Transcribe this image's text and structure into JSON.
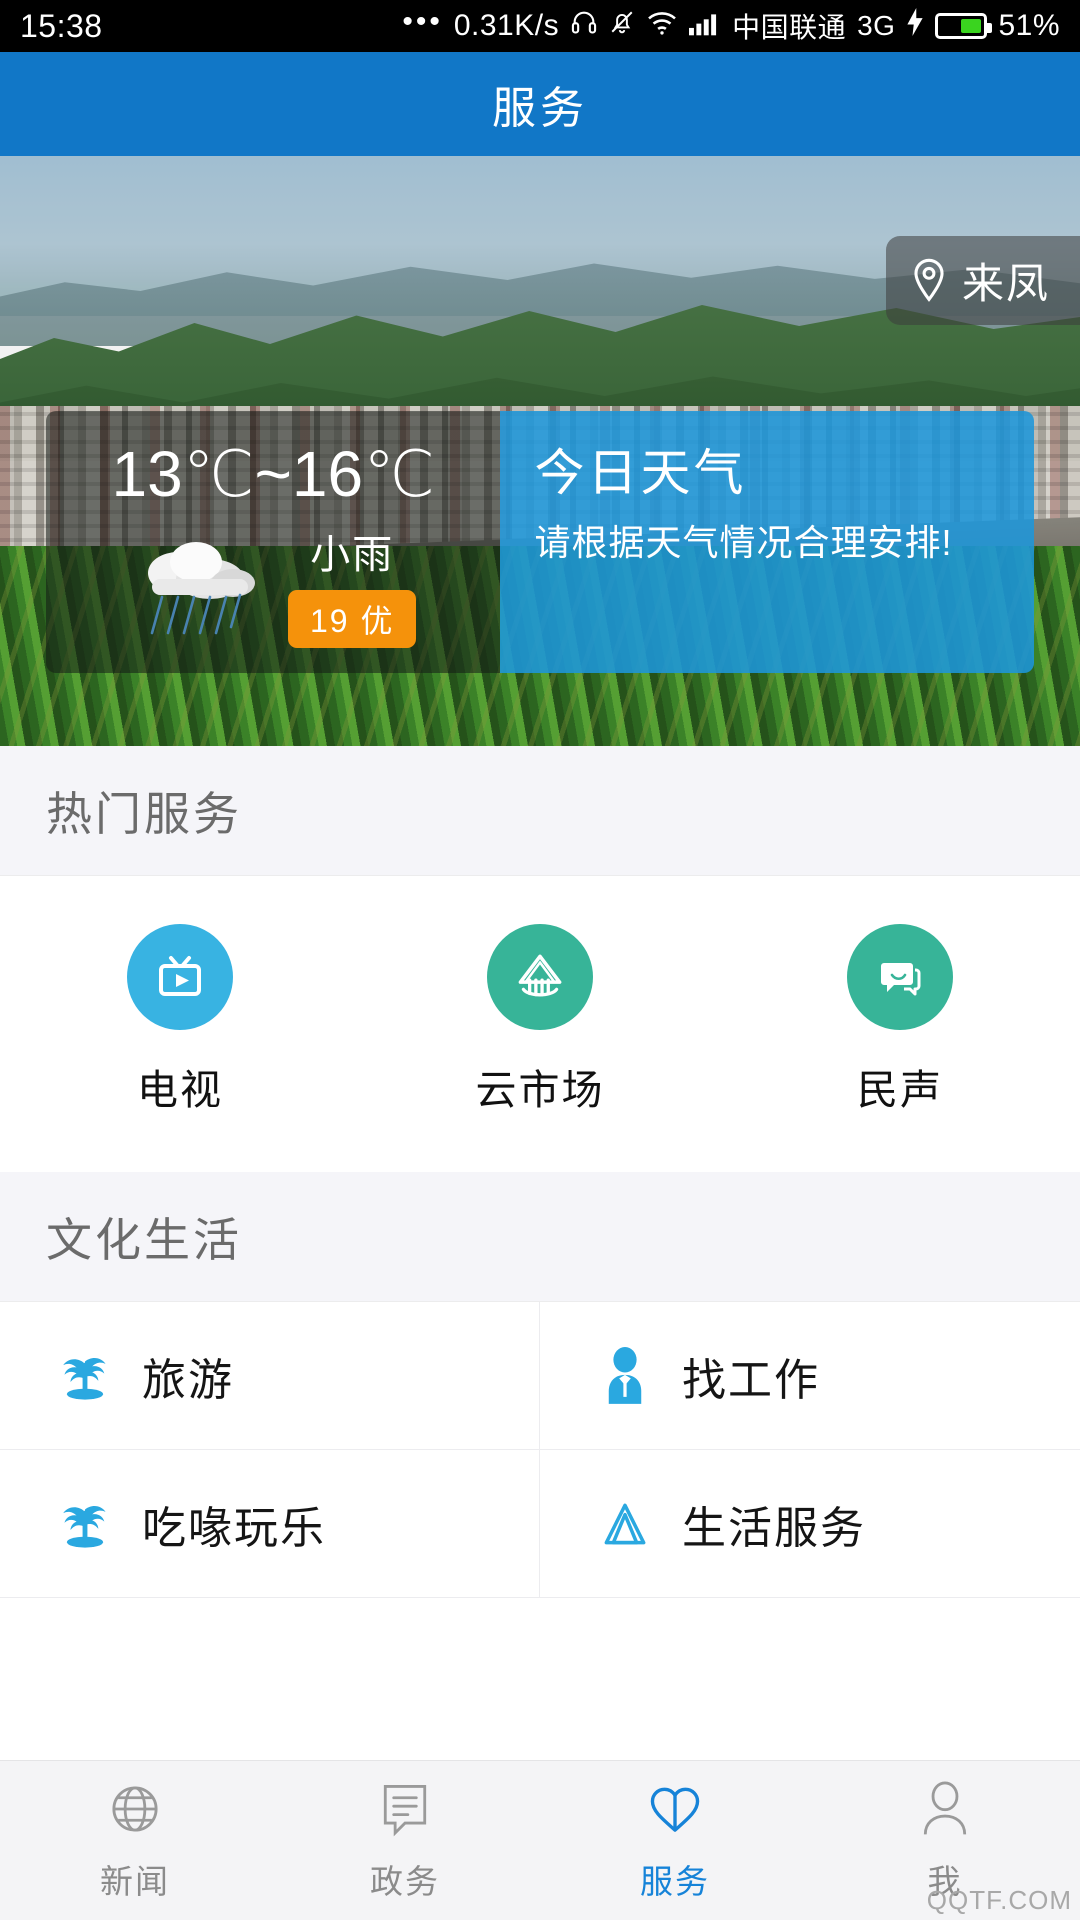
{
  "status_bar": {
    "time": "15:38",
    "dots": "•••",
    "net_speed": "0.31K/s",
    "carrier": "中国联通",
    "network_type": "3G",
    "battery_percent": "51%",
    "battery_level": 51,
    "icons": [
      "headphone-icon",
      "bell-muted-icon",
      "wifi-icon",
      "signal-icon",
      "charging-bolt-icon",
      "battery-icon"
    ]
  },
  "header": {
    "title": "服务"
  },
  "hero": {
    "location": {
      "label": "来凤",
      "icon": "location-pin-icon"
    },
    "weather": {
      "temperature_range": "13℃~16℃",
      "condition": "小雨",
      "condition_icon": "rain-cloud-icon",
      "aqi_badge": "19 优",
      "aqi_color": "#f5920b",
      "panel_title": "今日天气",
      "panel_desc": "请根据天气情况合理安排!",
      "panel_color": "#1e96d9"
    }
  },
  "hot_services": {
    "section_title": "热门服务",
    "items": [
      {
        "label": "电视",
        "icon": "tv-icon",
        "color": "#38b3e2"
      },
      {
        "label": "云市场",
        "icon": "cloud-market-icon",
        "color": "#37b498"
      },
      {
        "label": "民声",
        "icon": "chat-bubbles-icon",
        "color": "#37b498"
      }
    ]
  },
  "culture_life": {
    "section_title": "文化生活",
    "items": [
      {
        "label": "旅游",
        "icon": "palm-tree-icon",
        "color": "#2aa8e0"
      },
      {
        "label": "找工作",
        "icon": "person-suit-icon",
        "color": "#2aa8e0"
      },
      {
        "label": "吃喙玩乐",
        "icon": "palm-tree-icon",
        "color": "#2aa8e0"
      },
      {
        "label": "生活服务",
        "icon": "mountain-icon",
        "color": "#2aa8e0"
      }
    ]
  },
  "tabbar": {
    "active_color": "#1683d8",
    "items": [
      {
        "label": "新闻",
        "icon": "globe-icon",
        "active": false
      },
      {
        "label": "政务",
        "icon": "document-chat-icon",
        "active": false
      },
      {
        "label": "服务",
        "icon": "heart-icon",
        "active": true
      },
      {
        "label": "我",
        "icon": "person-icon",
        "active": false
      }
    ]
  },
  "watermark": "QQTF.COM"
}
